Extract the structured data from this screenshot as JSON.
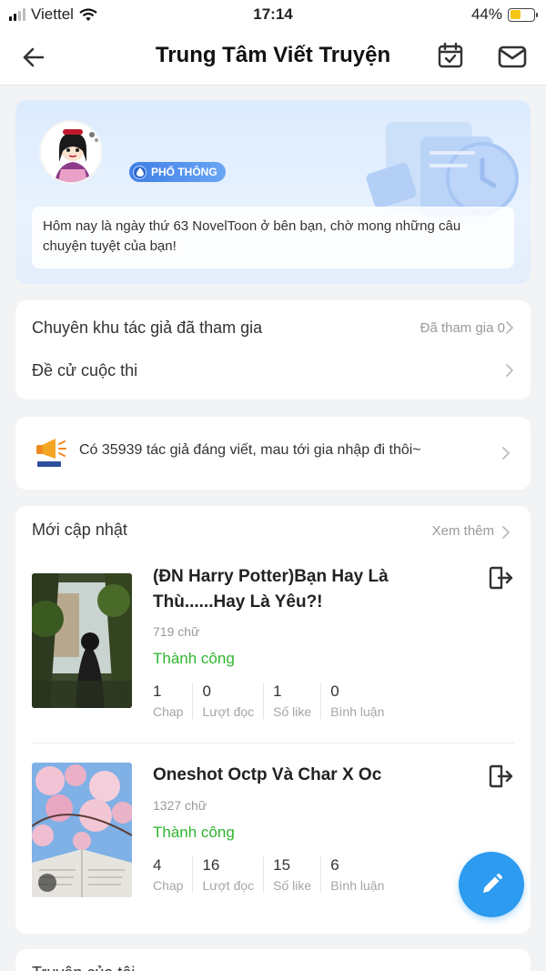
{
  "status_bar": {
    "carrier": "Viettel",
    "time": "17:14",
    "battery_percent": "44%",
    "battery_level": 0.44
  },
  "header": {
    "title": "Trung Tâm Viết Truyện"
  },
  "profile": {
    "badge": "PHỔ THÔNG",
    "message": "Hôm nay là ngày thứ 63 NovelToon ở bên bạn, chờ mong những câu chuyện tuyệt của bạn!"
  },
  "menu": {
    "items": [
      {
        "label": "Chuyên khu tác giả đã tham gia",
        "meta": "Đã tham gia 0"
      },
      {
        "label": "Đề cử cuộc thi",
        "meta": ""
      }
    ]
  },
  "notice": {
    "text": "Có 35939 tác giả đáng viết, mau tới gia nhập đi thôi~"
  },
  "updates": {
    "title": "Mới cập nhật",
    "more": "Xem thêm",
    "books": [
      {
        "title": "(ĐN Harry Potter)Bạn Hay Là Thù......Hay Là Yêu?!",
        "words": "719 chữ",
        "status": "Thành công",
        "stats": [
          {
            "num": "1",
            "label": "Chap"
          },
          {
            "num": "0",
            "label": "Lượt đọc"
          },
          {
            "num": "1",
            "label": "Số like"
          },
          {
            "num": "0",
            "label": "Bình luận"
          }
        ]
      },
      {
        "title": "Oneshot Octp Và Char X Oc",
        "words": "1327 chữ",
        "status": "Thành công",
        "stats": [
          {
            "num": "4",
            "label": "Chap"
          },
          {
            "num": "16",
            "label": "Lượt đọc"
          },
          {
            "num": "15",
            "label": "Số like"
          },
          {
            "num": "6",
            "label": "Bình luận"
          }
        ]
      }
    ]
  },
  "next_section": {
    "title": "Truyện của tôi"
  },
  "colors": {
    "accent": "#2d9bf0",
    "success": "#2fb52f",
    "badge": "#3f7fe6"
  },
  "icons": [
    "back-arrow-icon",
    "calendar-check-icon",
    "mail-icon",
    "chevron-right-icon",
    "megaphone-icon",
    "exit-icon",
    "pencil-icon",
    "water-drop-icon",
    "wifi-icon",
    "battery-icon",
    "signal-icon"
  ]
}
